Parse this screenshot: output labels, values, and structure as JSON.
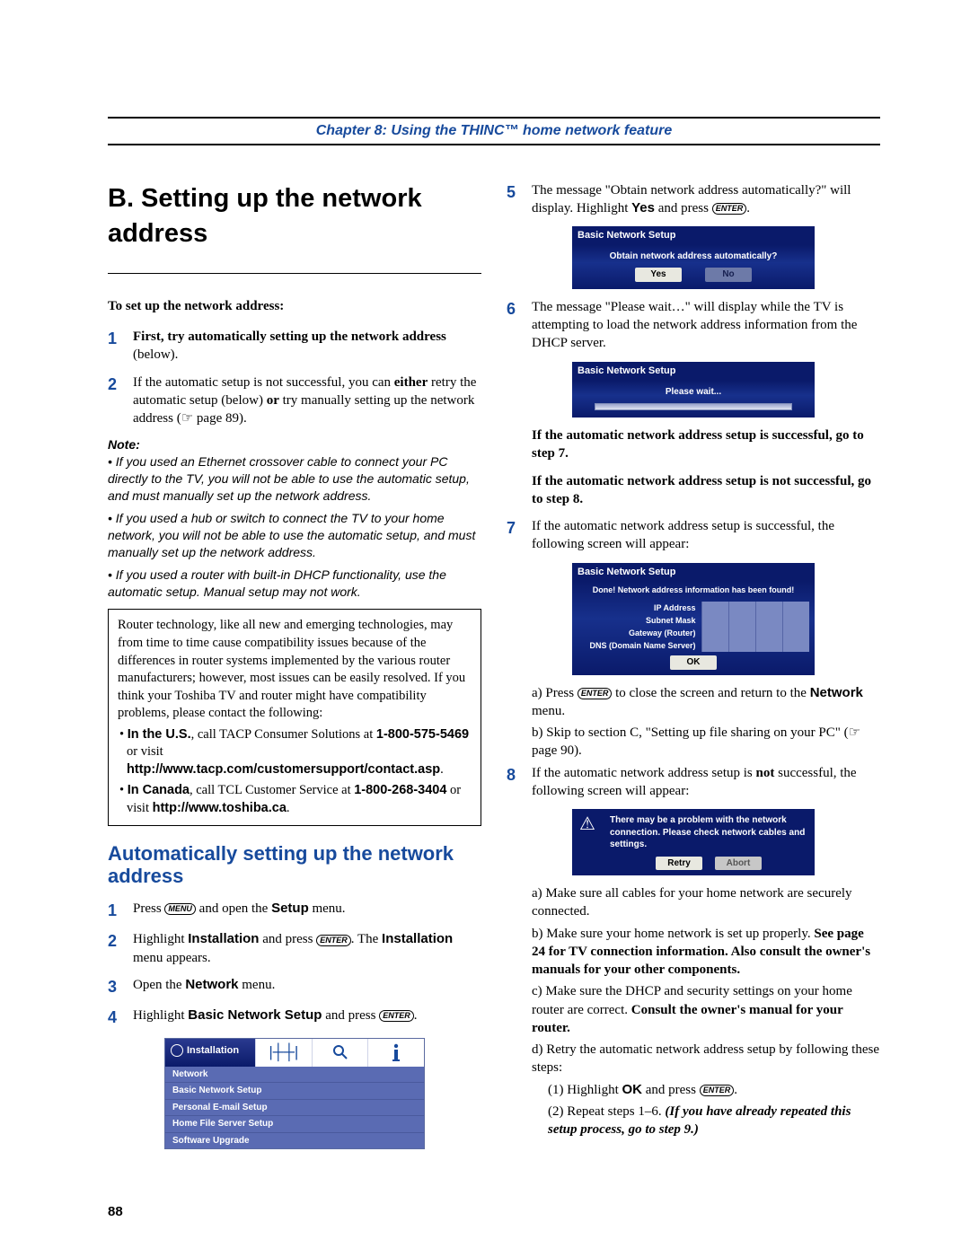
{
  "chapterLine": "Chapter 8: Using the THINC™ home network feature",
  "title": "B. Setting up the network address",
  "lead": "To set up the network address:",
  "steps12": {
    "s1": "First, try automatically setting up the network address",
    "s1b": "(below).",
    "s2a": "If the automatic setup is not successful, you can ",
    "s2b": "either",
    "s2c": " retry the automatic setup (below) ",
    "s2d": "or",
    "s2e": " try manually setting up the network address (☞ page 89)."
  },
  "noteHead": "Note:",
  "notes": [
    "If you used an Ethernet crossover cable to connect your PC directly to the TV, you will not be able to use the automatic setup, and must manually set up the network address.",
    "If you used a hub or switch to connect the TV to your home network, you will not be able to use the automatic setup, and must manually set up the network address.",
    "If you used a router with built-in DHCP functionality, use the automatic setup. Manual setup may not work."
  ],
  "boxed": {
    "intro": "Router technology, like all new and emerging technologies, may from time to time cause compatibility issues because of the differences in router systems implemented by the various router manufacturers; however, most issues can be easily resolved. If you think your Toshiba TV and router might have compatibility problems, please contact the following:",
    "us1": "In the U.S.",
    "us2": ", call TACP Consumer Solutions at ",
    "usPhone": "1-800-575-5469",
    "us3": " or visit ",
    "usUrl": "http://www.tacp.com/customersupport/contact.asp",
    "ca1": "In Canada",
    "ca2": ", call TCL Customer Service at ",
    "caPhone": "1-800-268-3404",
    "ca3": " or visit ",
    "caUrl": "http://www.toshiba.ca"
  },
  "subheading": "Automatically setting up the network address",
  "auto": {
    "s1a": "Press ",
    "s1b": " and open the ",
    "s1c": "Setup",
    "s1d": " menu.",
    "s2a": "Highlight ",
    "s2b": "Installation",
    "s2c": " and press ",
    "s2d": ". The ",
    "s2e": "Installation",
    "s2f": " menu appears.",
    "s3a": "Open the ",
    "s3b": "Network",
    "s3c": " menu.",
    "s4a": "Highlight ",
    "s4b": "Basic Network Setup",
    "s4c": " and press "
  },
  "menuIcon": "MENU",
  "enterIcon": "ENTER",
  "installMenu": {
    "side": "Installation",
    "header": "Network",
    "items": [
      "Basic Network Setup",
      "Personal E-mail Setup",
      "Home File Server Setup",
      "Software Upgrade"
    ]
  },
  "right": {
    "s5a": "The message \"Obtain network address automatically?\" will display. Highlight ",
    "s5b": "Yes",
    "s5c": " and press ",
    "osd1": {
      "title": "Basic Network Setup",
      "msg": "Obtain network address automatically?",
      "yes": "Yes",
      "no": "No"
    },
    "s6": "The message \"Please wait…\" will display while the TV is attempting to load the network address information from the DHCP server.",
    "osd2": {
      "title": "Basic Network Setup",
      "msg": "Please wait..."
    },
    "after6a": "If the automatic network address setup is successful, go to step 7.",
    "after6b": "If the automatic network address setup is not successful, go to step 8.",
    "s7": "If the automatic network address setup is successful, the following screen will appear:",
    "osd3": {
      "title": "Basic Network Setup",
      "msg": "Done! Network address information has been found!",
      "rows": [
        "IP Address",
        "Subnet Mask",
        "Gateway (Router)",
        "DNS (Domain Name Server)"
      ],
      "ok": "OK"
    },
    "s7a1": "a) Press ",
    "s7a2": " to close the screen and return to the ",
    "s7a3": "Network",
    "s7a4": " menu.",
    "s7b": "b) Skip to section C, \"Setting up file sharing on your PC\" (☞ page 90).",
    "s8a": "If the automatic network address setup is ",
    "s8b": "not",
    "s8c": " successful, the following screen will appear:",
    "osd4": {
      "msg": "There may be a problem with the network connection. Please check network cables and settings.",
      "retry": "Retry",
      "abort": "Abort"
    },
    "s8list": {
      "a": "a) Make sure all cables for your home network are securely connected.",
      "b1": "b) Make sure your home network is set up properly. ",
      "b2": "See page 24 for TV connection information. Also consult the owner's manuals for your other components.",
      "c1": "c) Make sure the DHCP and security settings on your home router are correct. ",
      "c2": "Consult the owner's manual for your router.",
      "d": "d) Retry the automatic network address setup by following these steps:",
      "d1a": "(1) Highlight ",
      "d1b": "OK",
      "d1c": " and press ",
      "d2a": "(2) Repeat steps 1–6. ",
      "d2b": "(If you have already repeated this setup process, go to step 9.)"
    }
  },
  "pageNumber": "88"
}
